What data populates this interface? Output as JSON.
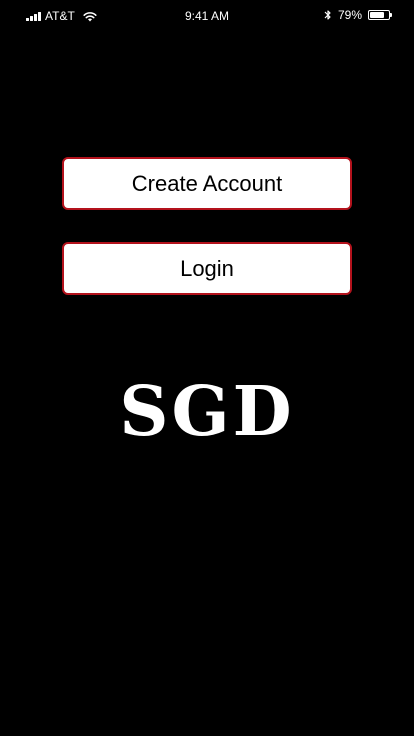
{
  "status_bar": {
    "carrier": "AT&T",
    "time": "9:41 AM",
    "battery_percent": "79%",
    "battery_level": 0.79,
    "icons": [
      "signal-icon",
      "wifi-icon",
      "bluetooth-icon",
      "battery-icon"
    ]
  },
  "buttons": {
    "create_account": "Create Account",
    "login": "Login"
  },
  "logo": {
    "text": "SGD"
  },
  "colors": {
    "background": "#000000",
    "button_fill": "#ffffff",
    "button_border": "#b3121c",
    "button_text": "#000000",
    "logo_text": "#ffffff"
  }
}
